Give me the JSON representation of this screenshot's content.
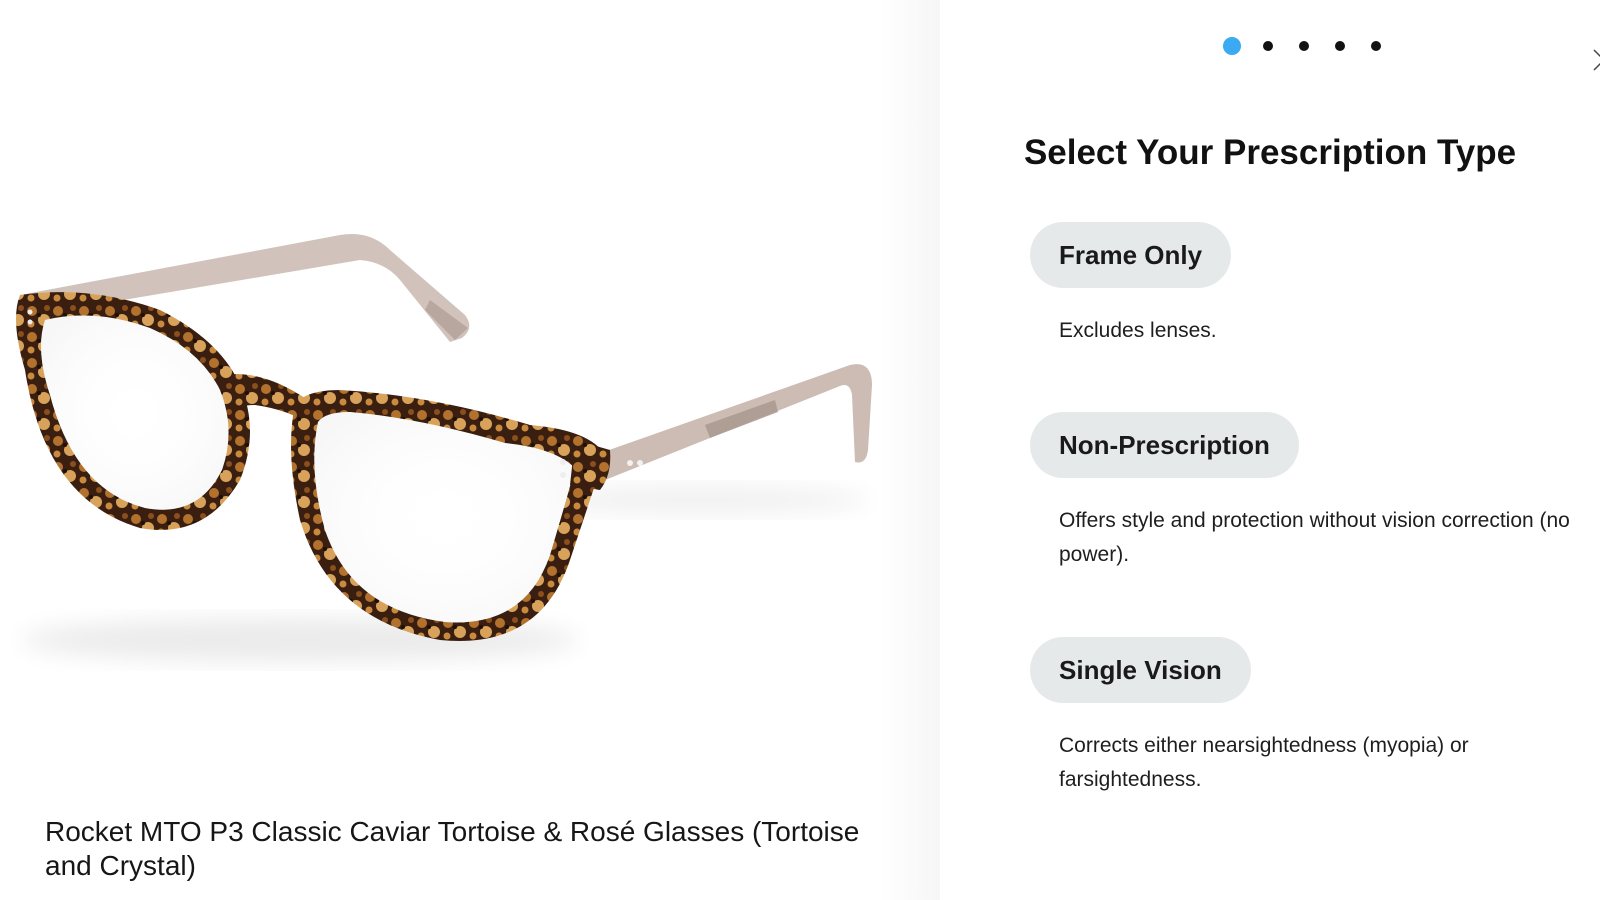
{
  "product": {
    "title": "Rocket MTO P3 Classic Caviar Tortoise & Rosé Glasses (Tortoise and Crystal)",
    "image_icon": "eyeglasses-image"
  },
  "wizard": {
    "steps_total": 5,
    "active_step": 1,
    "active_color": "#3aaaf2",
    "next_icon": "chevron-right-icon"
  },
  "selection": {
    "title": "Select Your Prescription Type",
    "options": [
      {
        "label": "Frame Only",
        "description": "Excludes lenses."
      },
      {
        "label": "Non-Prescription",
        "description": "Offers style and protection without vision correction (no power)."
      },
      {
        "label": "Single Vision",
        "description": "Corrects either nearsightedness (myopia) or farsightedness."
      }
    ]
  }
}
